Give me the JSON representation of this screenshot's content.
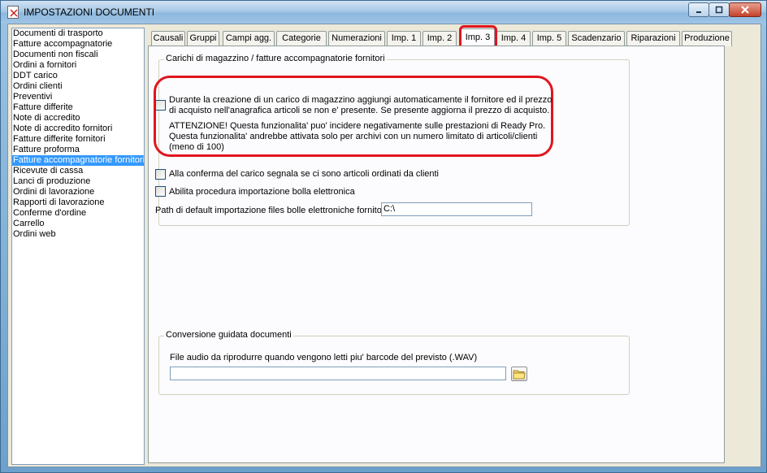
{
  "window": {
    "title": "IMPOSTAZIONI DOCUMENTI",
    "controls": {
      "minimize": "minimize",
      "maximize": "maximize",
      "close": "close"
    }
  },
  "sidebar": {
    "items": [
      "Documenti di trasporto",
      "Fatture accompagnatorie",
      "Documenti non fiscali",
      "Ordini a fornitori",
      "DDT carico",
      "Ordini clienti",
      "Preventivi",
      "Fatture differite",
      "Note di accredito",
      "Note di accredito fornitori",
      "Fatture differite fornitori",
      "Fatture proforma",
      "Fatture accompagnatorie fornitori",
      "Ricevute di cassa",
      "Lanci di produzione",
      "Ordini di lavorazione",
      "Rapporti di lavorazione",
      "Conferme d'ordine",
      "Carrello",
      "Ordini web"
    ],
    "selected_index": 12
  },
  "tabs": [
    "Causali",
    "Gruppi",
    "Campi agg.",
    "Categorie",
    "Numerazioni",
    "Imp. 1",
    "Imp. 2",
    "Imp. 3",
    "Imp. 4",
    "Imp. 5",
    "Scadenzario",
    "Riparazioni",
    "Produzione"
  ],
  "active_tab": "Imp. 3",
  "carichi_group": {
    "legend": "Carichi di magazzino / fatture accompagnatorie fornitori",
    "option1_line1": "Durante la creazione di un carico di magazzino aggiungi automaticamente il fornitore ed il prezzo",
    "option1_line2": "di acquisto nell'anagrafica articoli se non e' presente. Se presente aggiorna il prezzo di acquisto.",
    "warning_line1": "ATTENZIONE! Questa funzionalita' puo' incidere negativamente sulle prestazioni di Ready Pro.",
    "warning_line2": "Questa funzionalita' andrebbe attivata solo per archivi con un numero limitato di articoli/clienti",
    "warning_line3": "(meno di 100)",
    "option2": "Alla conferma del carico segnala se ci sono articoli ordinati da clienti",
    "option3": "Abilita procedura importazione bolla elettronica",
    "path_label": "Path di default importazione files bolle elettroniche fornitori",
    "path_value": "C:\\"
  },
  "conversione_group": {
    "legend": "Conversione guidata documenti",
    "audio_label": "File audio da riprodurre quando vengono letti piu' barcode del previsto  (.WAV)",
    "audio_value": ""
  }
}
